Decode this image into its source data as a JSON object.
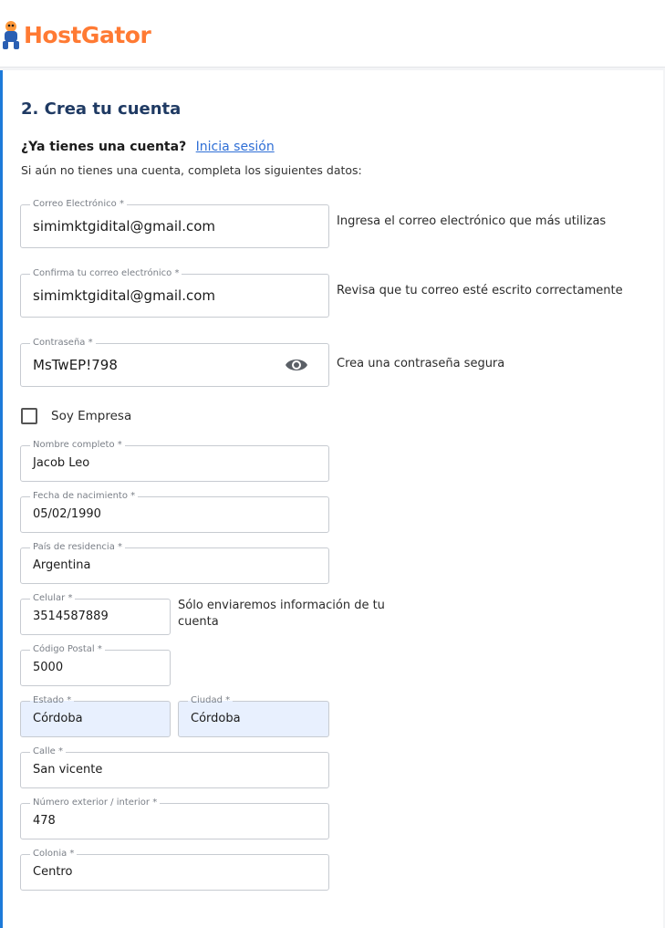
{
  "header": {
    "brand": "HostGator"
  },
  "section": {
    "title": "2. Crea tu cuenta",
    "account_question": "¿Ya tienes una cuenta?",
    "login_link": "Inicia sesión",
    "intro": "Si aún no tienes una cuenta, completa los siguientes datos:"
  },
  "fields": {
    "email": {
      "label": "Correo Electrónico *",
      "value": "simimktgidital@gmail.com",
      "hint": "Ingresa el correo electrónico que más utilizas"
    },
    "email_confirm": {
      "label": "Confirma tu correo electrónico *",
      "value": "simimktgidital@gmail.com",
      "hint": "Revisa que tu correo esté escrito correctamente"
    },
    "password": {
      "label": "Contraseña *",
      "value": "MsTwEP!798",
      "hint": "Crea una contraseña segura"
    },
    "company": {
      "label": "Soy Empresa",
      "checked": false
    },
    "full_name": {
      "label": "Nombre completo *",
      "value": "Jacob Leo"
    },
    "birth_date": {
      "label": "Fecha de nacimiento *",
      "value": "05/02/1990"
    },
    "country": {
      "label": "País de residencia *",
      "value": "Argentina"
    },
    "phone": {
      "label": "Celular *",
      "value": "3514587889",
      "hint": "Sólo enviaremos información de tu cuenta"
    },
    "postal_code": {
      "label": "Código Postal *",
      "value": "5000"
    },
    "state": {
      "label": "Estado *",
      "value": "Córdoba"
    },
    "city": {
      "label": "Ciudad *",
      "value": "Córdoba"
    },
    "street": {
      "label": "Calle *",
      "value": "San vicente"
    },
    "number": {
      "label": "Número exterior / interior *",
      "value": "478"
    },
    "neighborhood": {
      "label": "Colonia *",
      "value": "Centro"
    }
  },
  "colors": {
    "brand": "#ff7a33",
    "accent": "#1d7ad9",
    "title": "#1f3a63",
    "link": "#2f6fd6",
    "autofill": "#e8f0fe"
  }
}
